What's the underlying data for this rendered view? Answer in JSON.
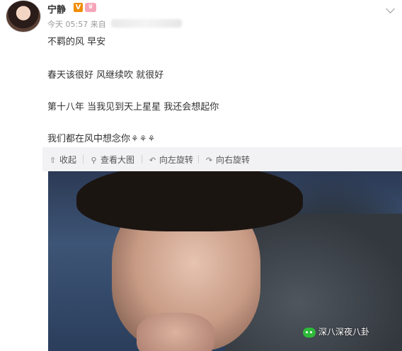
{
  "post": {
    "username": "宁静",
    "verified_badge": "V",
    "member_badge": "♛",
    "time": "今天 05:57 来自",
    "lines": [
      "不羁的风 早安",
      "春天该很好 风继续吹 就很好",
      "第十八年 当我见到天上星星 我还会想起你",
      "我们都在风中想念你"
    ],
    "flower_glyph": "⚘"
  },
  "toolbar": {
    "collapse": "收起",
    "view_large": "查看大图",
    "rotate_left": "向左旋转",
    "rotate_right": "向右旋转"
  },
  "watermark": "深八深夜八卦",
  "icons": {
    "collapse": "arrow-up-icon",
    "view_large": "magnifier-icon",
    "rotate_left": "rotate-left-icon",
    "rotate_right": "rotate-right-icon"
  },
  "colors": {
    "badge_orange": "#f08c00",
    "toolbar_bg": "#f2f2f5",
    "text": "#333333",
    "meta": "#999999"
  }
}
